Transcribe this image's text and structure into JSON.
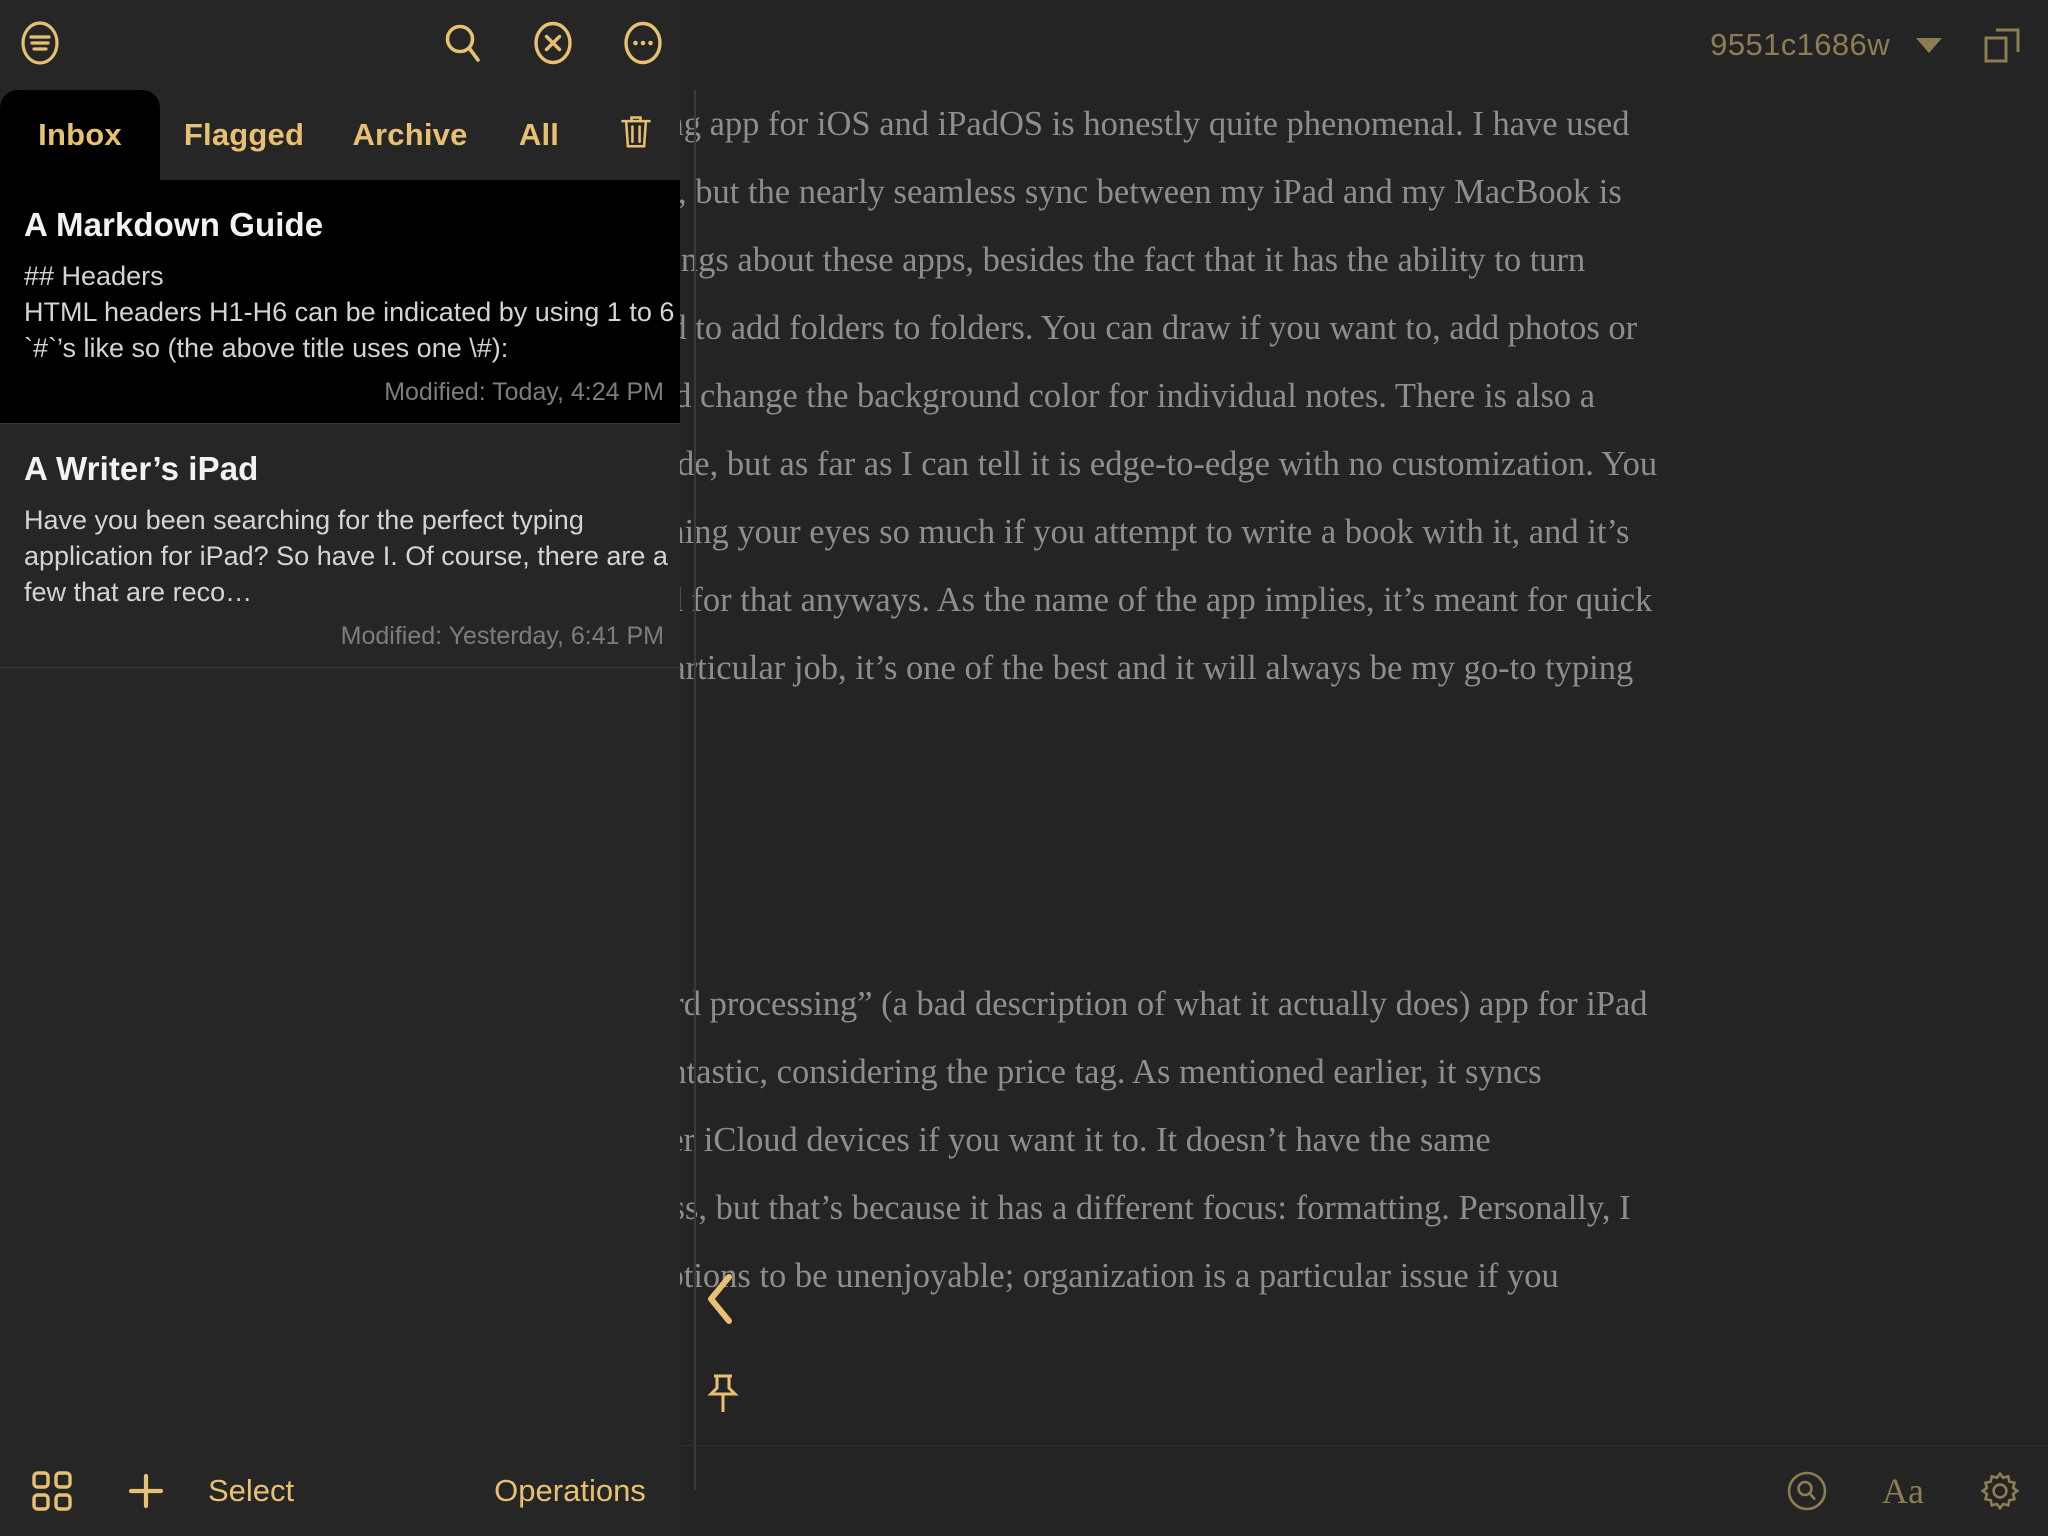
{
  "app": {
    "accent_gold": "#e8c072",
    "accent_dim_gold": "#8d7d52",
    "panel_bg": "#262626",
    "selected_bg": "#000000",
    "editor_bg": "#242424",
    "doc_text_color": "#8e8e8e"
  },
  "topbar": {
    "document_title": "9551c1686w",
    "title_chevron_icon": "chevron-down-icon",
    "split_view_icon": "window-split-icon"
  },
  "sidebar": {
    "toolbar": {
      "filter_icon": "filter-lines-circle-icon",
      "search_icon": "search-icon",
      "close_icon": "close-circle-icon",
      "more_icon": "more-circle-icon"
    },
    "tabs": [
      {
        "label": "Inbox",
        "active": true,
        "type": "text"
      },
      {
        "label": "Flagged",
        "active": false,
        "type": "text"
      },
      {
        "label": "Archive",
        "active": false,
        "type": "text"
      },
      {
        "label": "All",
        "active": false,
        "type": "text"
      },
      {
        "label": "",
        "active": false,
        "type": "icon",
        "icon": "trash-icon"
      }
    ],
    "notes": [
      {
        "title": "A Markdown Guide",
        "preview": "## Headers\nHTML headers H1-H6 can be indicated by using 1 to 6 `#`’s like so (the above title uses one \\#):",
        "modified": "Modified: Today, 4:24 PM",
        "selected": true
      },
      {
        "title": "A Writer’s iPad",
        "preview": "Have you been searching for the perfect typing application for iPad? So have I. Of course, there are a few that are reco…",
        "modified": "Modified: Yesterday, 6:41 PM",
        "selected": false
      }
    ],
    "bottombar": {
      "grid_icon": "grid-view-icon",
      "add_icon": "plus-icon",
      "select_label": "Select",
      "operations_label": "Operations"
    }
  },
  "document": {
    "paragraph_1": "The stock Notes typing app for iOS and iPadOS is honestly quite phenomenal. I have used both Notes and Pages, but the nearly seamless sync between my iPad and my MacBook is one of my favorite things about these apps, besides the fact that it has the ability to turn notes into folders, and to add folders to folders. You can draw if you want to, add photos or other attachments, and change the background color for individual notes. There is also a full-screen typing mode, but as far as I can tell it is edge-to-edge with no customization. You may get tired of straining your eyes so much if you attempt to write a book with it, and it’s probably not intended for that anyways. As the name of the app implies, it’s meant for quick note taking. At that particular job, it’s one of the best and it will always be my go-to typing app.",
    "paragraph_2": "Pages is Apple’s “word processing” (a bad description of what it actually does) app for iPad and Mac. It is also fantastic, considering the price tag. As mentioned earlier, it syncs perfectly with all other iCloud devices if you want it to. It doesn’t have the same organizational prowess, but that’s because it has a different focus: formatting. Personally, I find the formatting options to be unenjoyable; organization is a particular issue if you"
  },
  "overlays": {
    "back_chevron_icon": "chevron-left-icon",
    "pin_icon": "pin-icon"
  },
  "bottom_right_toolbar": {
    "find_icon": "find-in-page-icon",
    "typography_label": "Aa",
    "settings_icon": "gear-icon"
  }
}
